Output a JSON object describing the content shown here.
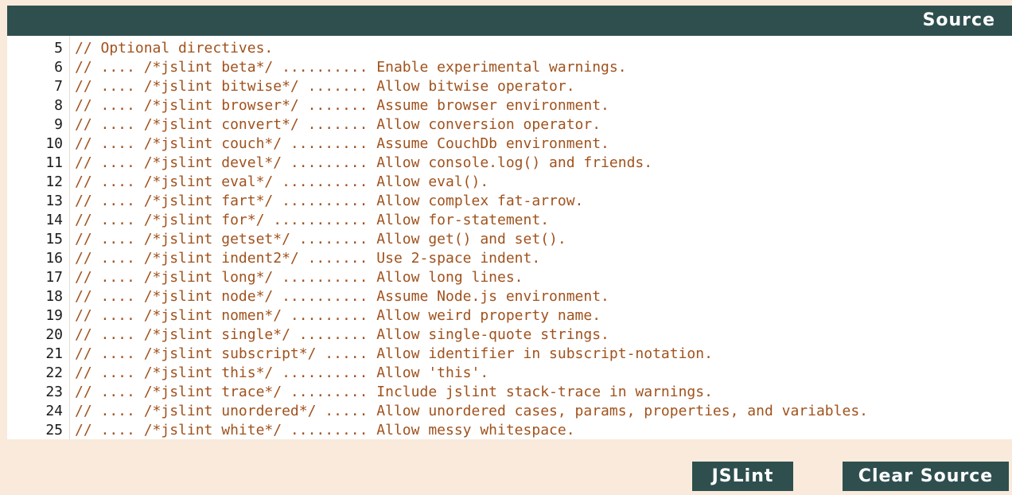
{
  "header": {
    "title": "Source"
  },
  "editor": {
    "lines": [
      {
        "num": "5",
        "text": "// Optional directives."
      },
      {
        "num": "6",
        "text": "// .... /*jslint beta*/ .......... Enable experimental warnings."
      },
      {
        "num": "7",
        "text": "// .... /*jslint bitwise*/ ....... Allow bitwise operator."
      },
      {
        "num": "8",
        "text": "// .... /*jslint browser*/ ....... Assume browser environment."
      },
      {
        "num": "9",
        "text": "// .... /*jslint convert*/ ....... Allow conversion operator."
      },
      {
        "num": "10",
        "text": "// .... /*jslint couch*/ ......... Assume CouchDb environment."
      },
      {
        "num": "11",
        "text": "// .... /*jslint devel*/ ......... Allow console.log() and friends."
      },
      {
        "num": "12",
        "text": "// .... /*jslint eval*/ .......... Allow eval()."
      },
      {
        "num": "13",
        "text": "// .... /*jslint fart*/ .......... Allow complex fat-arrow."
      },
      {
        "num": "14",
        "text": "// .... /*jslint for*/ ........... Allow for-statement."
      },
      {
        "num": "15",
        "text": "// .... /*jslint getset*/ ........ Allow get() and set()."
      },
      {
        "num": "16",
        "text": "// .... /*jslint indent2*/ ....... Use 2-space indent."
      },
      {
        "num": "17",
        "text": "// .... /*jslint long*/ .......... Allow long lines."
      },
      {
        "num": "18",
        "text": "// .... /*jslint node*/ .......... Assume Node.js environment."
      },
      {
        "num": "19",
        "text": "// .... /*jslint nomen*/ ......... Allow weird property name."
      },
      {
        "num": "20",
        "text": "// .... /*jslint single*/ ........ Allow single-quote strings."
      },
      {
        "num": "21",
        "text": "// .... /*jslint subscript*/ ..... Allow identifier in subscript-notation."
      },
      {
        "num": "22",
        "text": "// .... /*jslint this*/ .......... Allow 'this'."
      },
      {
        "num": "23",
        "text": "// .... /*jslint trace*/ ......... Include jslint stack-trace in warnings."
      },
      {
        "num": "24",
        "text": "// .... /*jslint unordered*/ ..... Allow unordered cases, params, properties, and variables."
      },
      {
        "num": "25",
        "text": "// .... /*jslint white*/ ......... Allow messy whitespace."
      }
    ]
  },
  "buttons": {
    "jslint_label": "JSLint",
    "clear_label": "Clear Source"
  },
  "colors": {
    "page_background": "#f9eadb",
    "header_background": "#2f4f4f",
    "code_text": "#a0521d",
    "line_number": "#1a1a1a"
  }
}
